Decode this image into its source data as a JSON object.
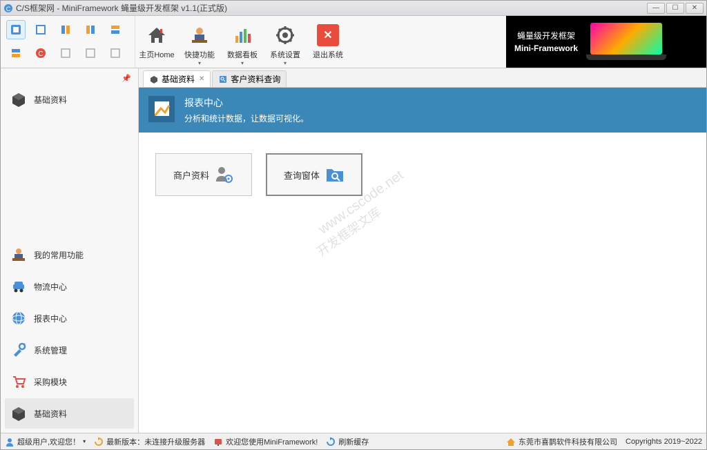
{
  "title": "C/S框架网 - MiniFramework 蝇量级开发框架 v1.1(正式版)",
  "ribbon": {
    "home": "主页Home",
    "quick": "快捷功能",
    "data": "数据看板",
    "settings": "系统设置",
    "exit": "退出系统",
    "banner_line1": "蝇量级开发框架",
    "banner_line2": "Mini-Framework"
  },
  "sidebar": {
    "top": "基础资料",
    "items": [
      "我的常用功能",
      "物流中心",
      "报表中心",
      "系统管理",
      "采购模块",
      "基础资料"
    ]
  },
  "tabs": [
    {
      "label": "基础资料",
      "active": true
    },
    {
      "label": "客户资料查询",
      "active": false
    }
  ],
  "bluebar": {
    "title": "报表中心",
    "subtitle": "分析和统计数据，让数据可视化。"
  },
  "cards": [
    {
      "label": "商户资料"
    },
    {
      "label": "查询窗体"
    }
  ],
  "watermark1": "www.cscode.net",
  "watermark2": "开发框架文库",
  "status": {
    "user": "超级用户,欢迎您！",
    "version": "最新版本：未连接升级服务器",
    "welcome": "欢迎您使用MiniFramework!",
    "refresh": "刷新缓存",
    "company": "东莞市喜鹊软件科技有限公司",
    "copyright": "Copyrights 2019~2022"
  }
}
